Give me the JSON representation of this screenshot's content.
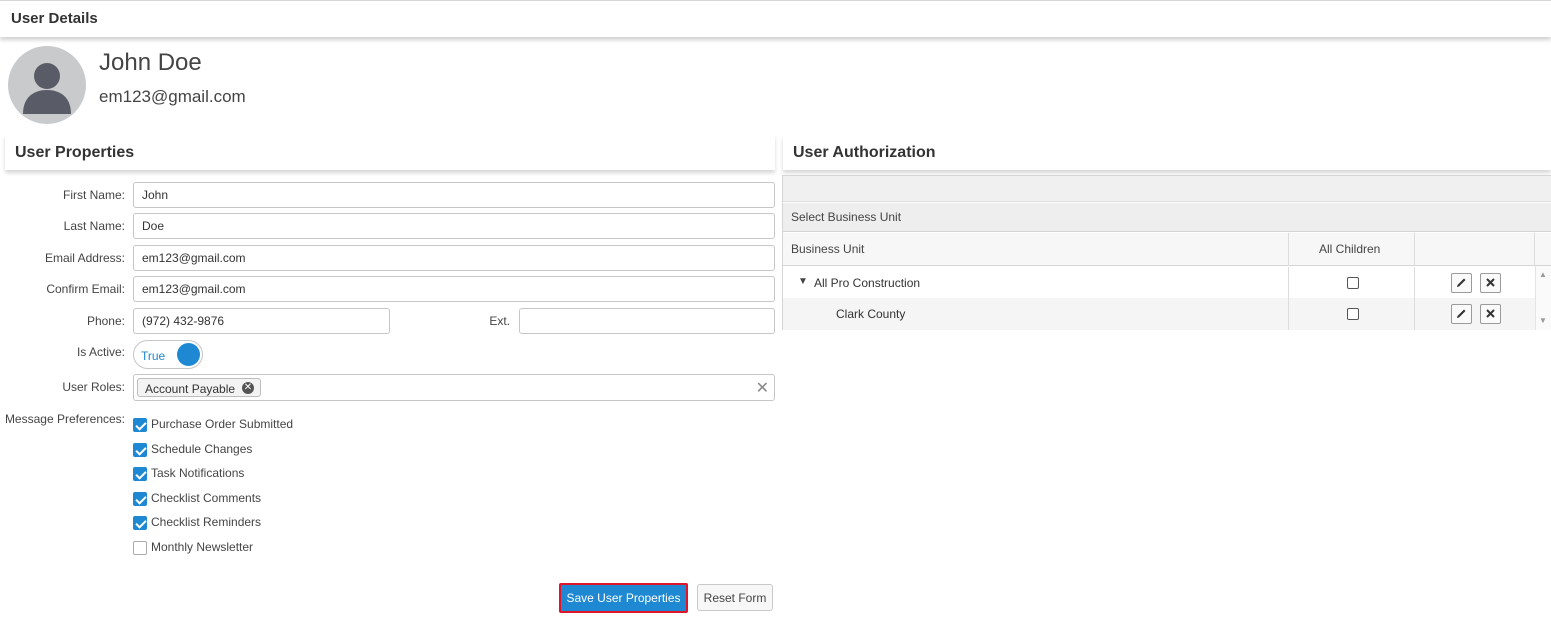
{
  "page": {
    "title": "User Details"
  },
  "user": {
    "name": "John Doe",
    "email": "em123@gmail.com"
  },
  "properties": {
    "title": "User Properties",
    "first_name": {
      "label": "First Name:",
      "value": "John"
    },
    "last_name": {
      "label": "Last Name:",
      "value": "Doe"
    },
    "email": {
      "label": "Email Address:",
      "value": "em123@gmail.com"
    },
    "confirm_email": {
      "label": "Confirm Email:",
      "value": "em123@gmail.com"
    },
    "phone": {
      "label": "Phone:",
      "value": "(972) 432-9876"
    },
    "ext": {
      "label": "Ext.",
      "value": ""
    },
    "is_active": {
      "label": "Is Active:",
      "value": "True"
    },
    "roles": {
      "label": "User Roles:",
      "chips": [
        "Account Payable"
      ],
      "clear_glyph": "✕"
    },
    "message_preferences": {
      "label": "Message Preferences:",
      "items": [
        {
          "label": "Purchase Order Submitted",
          "checked": true
        },
        {
          "label": "Schedule Changes",
          "checked": true
        },
        {
          "label": "Task Notifications",
          "checked": true
        },
        {
          "label": "Checklist Comments",
          "checked": true
        },
        {
          "label": "Checklist Reminders",
          "checked": true
        },
        {
          "label": "Monthly Newsletter",
          "checked": false
        }
      ]
    },
    "save_label": "Save User Properties",
    "reset_label": "Reset Form"
  },
  "authorization": {
    "title": "User Authorization",
    "group_label": "Select Business Unit",
    "columns": [
      "Business Unit",
      "All Children",
      ""
    ],
    "rows": [
      {
        "name": "All Pro Construction",
        "expanded": true,
        "level": 0,
        "all_children": false
      },
      {
        "name": "Clark County",
        "expanded": false,
        "level": 1,
        "all_children": false
      }
    ]
  },
  "colors": {
    "accent": "#1e88d2",
    "highlight_border": "#e0152a",
    "avatar_bg": "#c9cacc"
  },
  "icons": [
    "user-avatar-icon",
    "chip-remove-icon",
    "clear-icon",
    "checkbox-icon",
    "caret-down-icon",
    "edit-icon",
    "delete-icon",
    "scroll-up-icon",
    "scroll-down-icon"
  ]
}
